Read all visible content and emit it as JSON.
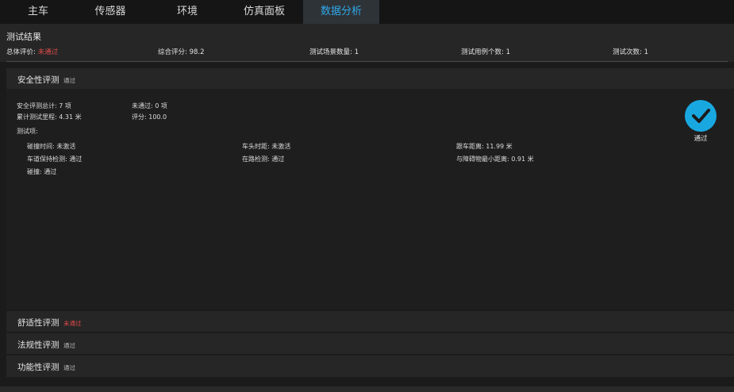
{
  "tabs": [
    {
      "label": "主车"
    },
    {
      "label": "传感器"
    },
    {
      "label": "环境"
    },
    {
      "label": "仿真面板"
    },
    {
      "label": "数据分析"
    }
  ],
  "results": {
    "title": "测试结果",
    "overall_label": "总体评价:",
    "overall_value": "未通过",
    "score": "综合评分: 98.2",
    "scenario_count": "测试场景数量: 1",
    "case_count": "测试用例个数: 1",
    "run_count": "测试次数: 1"
  },
  "safety": {
    "title": "安全性评测",
    "status": "通过",
    "total": "安全评测总计: 7 项",
    "failed": "未通过: 0 项",
    "mileage": "累计测试里程: 4.31 米",
    "score": "评分: 100.0",
    "items_label": "测试项:",
    "items": [
      "碰撞时间: 未激活",
      "车头时距: 未激活",
      "跟车距离: 11.99 米",
      "车道保持检测: 通过",
      "在路检测: 通过",
      "与障碍物最小距离: 0.91 米",
      "碰撞: 通过"
    ],
    "badge_label": "通过",
    "badge_color": "#19a7e0"
  },
  "comfort": {
    "title": "舒适性评测",
    "status": "未通过"
  },
  "regulation": {
    "title": "法规性评测",
    "status": "通过"
  },
  "function": {
    "title": "功能性评测",
    "status": "通过"
  },
  "colors": {
    "accent": "#2fa8e8",
    "fail": "#e14b4b",
    "pass_badge": "#19a7e0"
  }
}
